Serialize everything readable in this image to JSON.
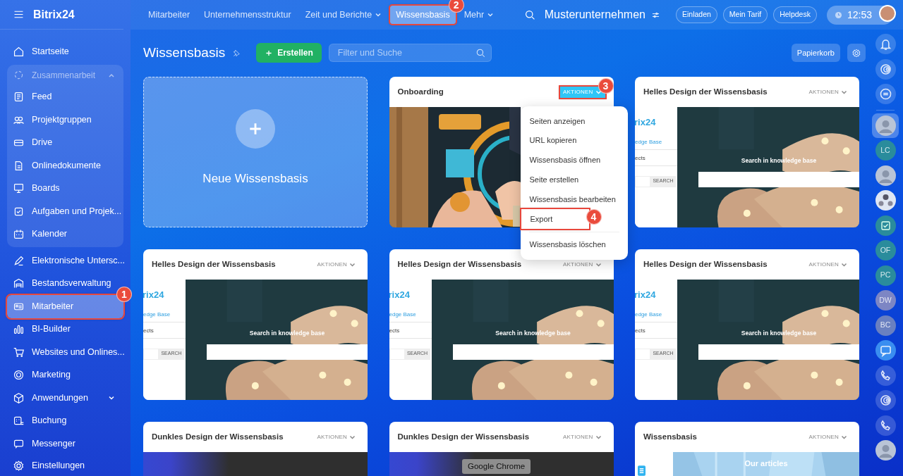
{
  "sidebar": {
    "logo": "Bitrix24",
    "items": [
      {
        "kind": "item",
        "label": "Startseite",
        "selected": false
      },
      {
        "kind": "group",
        "label": "Zusammenarbeit",
        "expanded": true,
        "children": [
          {
            "label": "Feed",
            "selected": false
          },
          {
            "label": "Projektgruppen",
            "selected": false
          },
          {
            "label": "Drive",
            "selected": false
          },
          {
            "label": "Onlinedokumente",
            "selected": false
          },
          {
            "label": "Boards",
            "selected": false
          },
          {
            "label": "Aufgaben und Projek...",
            "selected": false
          },
          {
            "label": "Kalender",
            "selected": false
          }
        ]
      },
      {
        "kind": "item",
        "label": "Elektronische Untersc...",
        "selected": false
      },
      {
        "kind": "item",
        "label": "Bestandsverwaltung",
        "selected": false
      },
      {
        "kind": "item",
        "label": "Mitarbeiter",
        "selected": true,
        "callout": "1"
      },
      {
        "kind": "item",
        "label": "BI-Builder",
        "selected": false
      },
      {
        "kind": "item",
        "label": "Websites und Onlines...",
        "selected": false
      },
      {
        "kind": "item",
        "label": "Marketing",
        "selected": false
      },
      {
        "kind": "group",
        "label": "Anwendungen",
        "expanded": false
      },
      {
        "kind": "item",
        "label": "Buchung",
        "selected": false
      },
      {
        "kind": "item",
        "label": "Messenger",
        "selected": false
      }
    ],
    "footer": "Einstellungen"
  },
  "top_nav": [
    {
      "label": "Mitarbeiter",
      "selected": false,
      "dropdown": false
    },
    {
      "label": "Unternehmensstruktur",
      "selected": false,
      "dropdown": false
    },
    {
      "label": "Zeit und Berichte",
      "selected": false,
      "dropdown": true
    },
    {
      "label": "Wissensbasis",
      "selected": true,
      "dropdown": false,
      "callout": "2"
    },
    {
      "label": "Mehr",
      "selected": false,
      "dropdown": true
    }
  ],
  "header": {
    "company": "Musterunternehmen",
    "buttons": [
      "Einladen",
      "Mein Tarif",
      "Helpdesk"
    ],
    "time": "12:53"
  },
  "page": {
    "title": "Wissensbasis",
    "create_button": "Erstellen",
    "search": {
      "placeholder": "Filter und Suche"
    },
    "trash_button": "Papierkorb"
  },
  "cards": [
    {
      "kind": "new",
      "label": "Neue Wissensbasis"
    },
    {
      "kind": "picture",
      "title": "Onboarding",
      "actions": {
        "label": "AKTIONEN",
        "active": true,
        "callout": "3"
      },
      "menu": {
        "items": [
          {
            "label": "Seiten anzeigen",
            "separated": false
          },
          {
            "label": "URL kopieren",
            "separated": false
          },
          {
            "label": "Wissensbasis öffnen",
            "separated": false
          },
          {
            "label": "Seite erstellen",
            "separated": false
          },
          {
            "label": "Wissensbasis bearbeiten",
            "separated": false
          },
          {
            "label": "Export",
            "separated": false,
            "callout": "4"
          },
          {
            "label": "Wissensbasis löschen",
            "separated": true
          }
        ]
      }
    },
    {
      "kind": "light",
      "title": "Helles Design der Wissensbasis",
      "actions": {
        "label": "AKTIONEN",
        "active": false
      },
      "preview": {
        "logo": "rix24",
        "link_1": "edge Base",
        "link_2": "ects",
        "search_button": "SEARCH",
        "heading": "Search in knowledge base"
      }
    },
    {
      "kind": "light",
      "title": "Helles Design der Wissensbasis",
      "actions": {
        "label": "AKTIONEN",
        "active": false
      },
      "preview": {
        "logo": "rix24",
        "link_1": "edge Base",
        "link_2": "ects",
        "search_button": "SEARCH",
        "heading": "Search in knowledge base"
      }
    },
    {
      "kind": "light",
      "title": "Helles Design der Wissensbasis",
      "actions": {
        "label": "AKTIONEN",
        "active": false
      },
      "preview": {
        "logo": "rix24",
        "link_1": "edge Base",
        "link_2": "ects",
        "search_button": "SEARCH",
        "heading": "Search in knowledge base"
      }
    },
    {
      "kind": "light",
      "title": "Helles Design der Wissensbasis",
      "actions": {
        "label": "AKTIONEN",
        "active": false
      },
      "preview": {
        "logo": "rix24",
        "link_1": "edge Base",
        "link_2": "ects",
        "search_button": "SEARCH",
        "heading": "Search in knowledge base"
      }
    },
    {
      "kind": "dark",
      "title": "Dunkles Design der Wissensbasis",
      "actions": {
        "label": "AKTIONEN",
        "active": false
      }
    },
    {
      "kind": "dark",
      "title": "Dunkles Design der Wissensbasis",
      "actions": {
        "label": "AKTIONEN",
        "active": false
      }
    },
    {
      "kind": "articles",
      "title": "Wissensbasis",
      "actions": {
        "label": "AKTIONEN",
        "active": false
      },
      "preview": {
        "heading": "Our articles"
      }
    }
  ],
  "right_rail": [
    {
      "kind": "bell",
      "selected": false
    },
    {
      "kind": "spiral",
      "selected": false
    },
    {
      "kind": "chat",
      "selected": false
    },
    {
      "kind": "avatar",
      "selected": true
    },
    {
      "kind": "initials",
      "label": "LC",
      "color": "#2a8c9c",
      "selected": false
    },
    {
      "kind": "avatar",
      "selected": false
    },
    {
      "kind": "group",
      "selected": false
    },
    {
      "kind": "check",
      "selected": false
    },
    {
      "kind": "initials",
      "label": "OF",
      "color": "#2a8c9c",
      "selected": false
    },
    {
      "kind": "initials",
      "label": "PC",
      "color": "#2a8c9c",
      "selected": false
    },
    {
      "kind": "initials",
      "label": "DW",
      "color": "#7d86c4",
      "selected": false
    },
    {
      "kind": "initials",
      "label": "BC",
      "color": "#6a80c0",
      "selected": false
    },
    {
      "kind": "chat_fill",
      "selected": false
    },
    {
      "kind": "phone",
      "selected": false
    },
    {
      "kind": "spiral",
      "selected": false
    },
    {
      "kind": "phone",
      "selected": false
    },
    {
      "kind": "avatar",
      "selected": false
    }
  ],
  "tooltip": "Google Chrome"
}
